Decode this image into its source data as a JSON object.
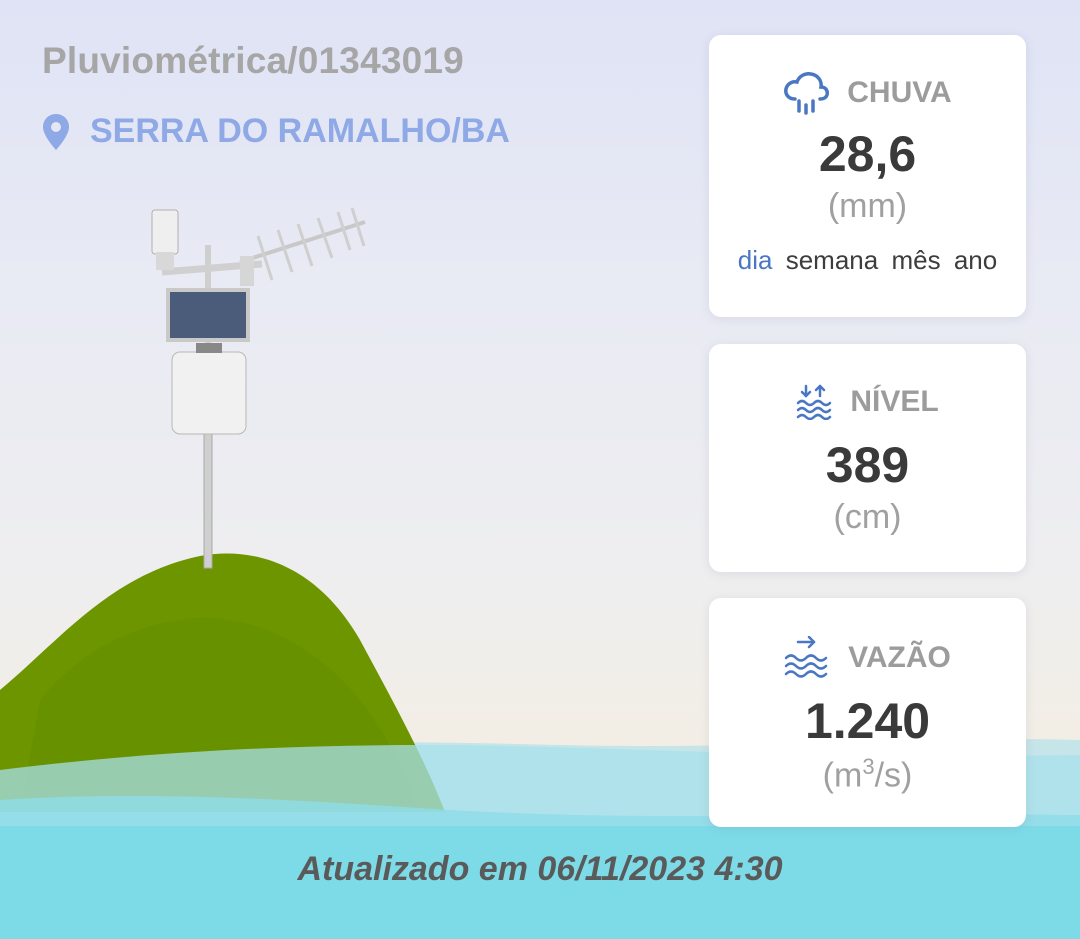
{
  "station": {
    "title": "Pluviométrica/01343019",
    "location": "SERRA DO RAMALHO/BA",
    "location_icon": "map-pin-icon"
  },
  "cards": {
    "chuva": {
      "label": "CHUVA",
      "value": "28,6",
      "unit": "(mm)",
      "icon": "rain-cloud-icon",
      "periods": [
        "dia",
        "semana",
        "mês",
        "ano"
      ],
      "active_period": "dia"
    },
    "nivel": {
      "label": "NÍVEL",
      "value": "389",
      "unit": "(cm)",
      "icon": "water-level-icon"
    },
    "vazao": {
      "label": "VAZÃO",
      "value": "1.240",
      "unit_prefix": "(m",
      "unit_sup": "3",
      "unit_suffix": "/s)",
      "icon": "water-flow-icon"
    }
  },
  "footer": {
    "updated": "Atualizado em 06/11/2023 4:30"
  },
  "colors": {
    "accent": "#4a77c4",
    "location_text": "#8fa8e6",
    "hill": "#6b9400",
    "water": "#7fdbe8"
  }
}
